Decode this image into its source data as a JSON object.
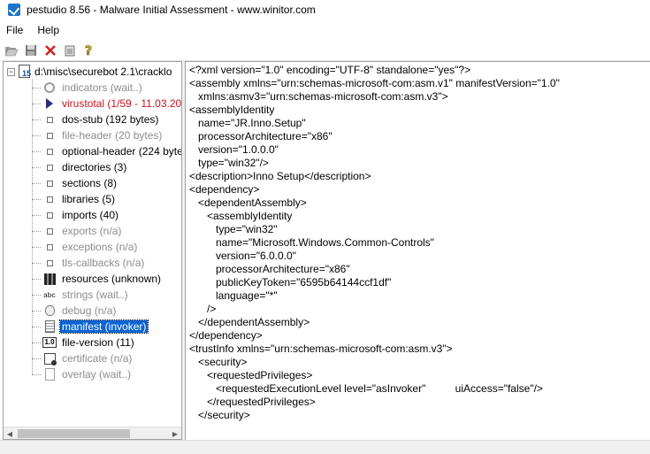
{
  "window": {
    "title": "pestudio 8.56 - Malware Initial Assessment - www.winitor.com"
  },
  "menu": {
    "items": [
      "File",
      "Help"
    ]
  },
  "toolbar": {
    "buttons": [
      "open-icon",
      "save-icon",
      "close-icon",
      "clipboard-icon",
      "help-icon"
    ]
  },
  "tree": {
    "root_label": "d:\\misc\\securebot 2.1\\cracklo",
    "items": [
      {
        "label": "indicators (wait..)",
        "state": "gray",
        "icon": "indicators-icon"
      },
      {
        "label": "virustotal (1/59 - 11.03.201",
        "state": "red",
        "icon": "virustotal-icon"
      },
      {
        "label": "dos-stub (192 bytes)",
        "state": "black",
        "icon": "node-icon"
      },
      {
        "label": "file-header (20 bytes)",
        "state": "gray",
        "icon": "node-icon"
      },
      {
        "label": "optional-header (224 bytes",
        "state": "black",
        "icon": "node-icon"
      },
      {
        "label": "directories (3)",
        "state": "black",
        "icon": "node-icon"
      },
      {
        "label": "sections (8)",
        "state": "black",
        "icon": "node-icon"
      },
      {
        "label": "libraries (5)",
        "state": "black",
        "icon": "node-icon"
      },
      {
        "label": "imports (40)",
        "state": "black",
        "icon": "node-icon"
      },
      {
        "label": "exports (n/a)",
        "state": "gray",
        "icon": "node-icon"
      },
      {
        "label": "exceptions (n/a)",
        "state": "gray",
        "icon": "node-icon"
      },
      {
        "label": "tls-callbacks (n/a)",
        "state": "gray",
        "icon": "node-icon"
      },
      {
        "label": "resources (unknown)",
        "state": "black",
        "icon": "resources-icon"
      },
      {
        "label": "strings (wait..)",
        "state": "gray",
        "icon": "strings-icon",
        "icon_text": "abc"
      },
      {
        "label": "debug (n/a)",
        "state": "gray",
        "icon": "debug-icon"
      },
      {
        "label": "manifest (invoker)",
        "state": "selected",
        "icon": "manifest-icon"
      },
      {
        "label": "file-version (11)",
        "state": "black",
        "icon": "file-version-icon",
        "icon_text": "1.0"
      },
      {
        "label": "certificate (n/a)",
        "state": "gray",
        "icon": "certificate-icon"
      },
      {
        "label": "overlay (wait..)",
        "state": "gray",
        "icon": "overlay-icon"
      }
    ]
  },
  "xml": {
    "lines": [
      "<?xml version=\"1.0\" encoding=\"UTF-8\" standalone=\"yes\"?>",
      "<assembly xmlns=\"urn:schemas-microsoft-com:asm.v1\" manifestVersion=\"1.0\"",
      "   xmlns:asmv3=\"urn:schemas-microsoft-com:asm.v3\">",
      "<assemblyIdentity",
      "   name=\"JR.Inno.Setup\"",
      "   processorArchitecture=\"x86\"",
      "   version=\"1.0.0.0\"",
      "   type=\"win32\"/>",
      "<description>Inno Setup</description>",
      "<dependency>",
      "   <dependentAssembly>",
      "      <assemblyIdentity",
      "         type=\"win32\"",
      "         name=\"Microsoft.Windows.Common-Controls\"",
      "         version=\"6.0.0.0\"",
      "         processorArchitecture=\"x86\"",
      "         publicKeyToken=\"6595b64144ccf1df\"",
      "         language=\"*\"",
      "      />",
      "   </dependentAssembly>",
      "</dependency>",
      "<trustInfo xmlns=\"urn:schemas-microsoft-com:asm.v3\">",
      "   <security>",
      "      <requestedPrivileges>",
      "         <requestedExecutionLevel level=\"asInvoker\"          uiAccess=\"false\"/>",
      "      </requestedPrivileges>",
      "   </security>"
    ]
  }
}
